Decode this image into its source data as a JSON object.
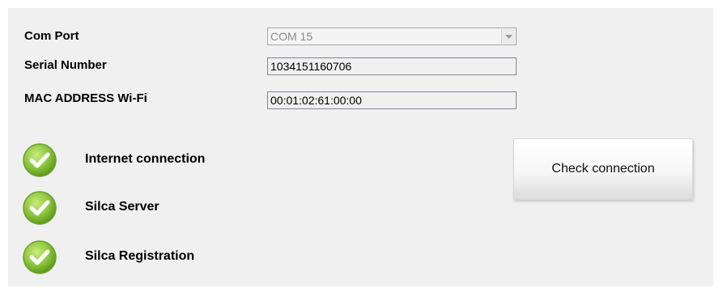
{
  "form": {
    "com_port": {
      "label": "Com Port",
      "value": "COM 15"
    },
    "serial_number": {
      "label": "Serial Number",
      "value": "1034151160706"
    },
    "mac_address": {
      "label": "MAC ADDRESS Wi-Fi",
      "value": "00:01:02:61:00:00"
    }
  },
  "status": [
    {
      "label": "Internet connection",
      "state": "ok",
      "icon": "check-icon"
    },
    {
      "label": "Silca Server",
      "state": "ok",
      "icon": "check-icon"
    },
    {
      "label": "Silca Registration",
      "state": "ok",
      "icon": "check-icon"
    }
  ],
  "actions": {
    "check_connection_label": "Check connection"
  },
  "colors": {
    "panel_background": "#f0f0f0",
    "status_ok": "#8cc63f"
  }
}
